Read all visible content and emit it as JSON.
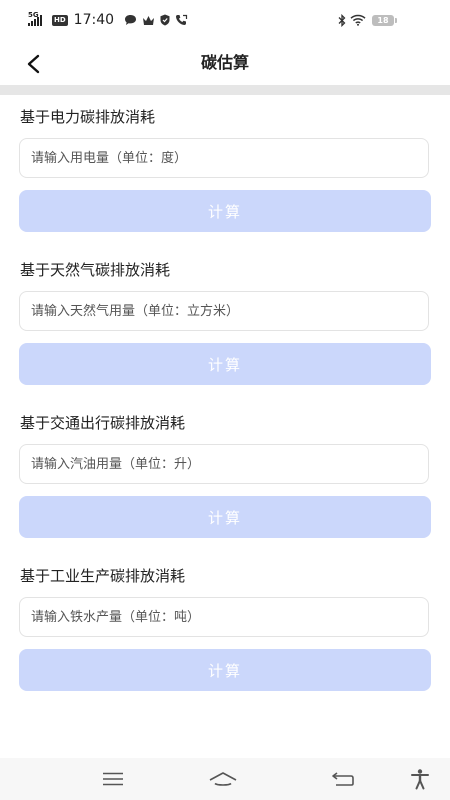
{
  "status_bar": {
    "network_label": "5G",
    "hd_label": "HD",
    "time": "17:40",
    "battery_level": "18"
  },
  "header": {
    "title": "碳估算",
    "back_icon": "chevron-left-icon"
  },
  "sections": [
    {
      "title": "基于电力碳排放消耗",
      "input_placeholder": "请输入用电量（单位：度）",
      "input_value": "",
      "button_label": "计算"
    },
    {
      "title": "基于天然气碳排放消耗",
      "input_placeholder": "请输入天然气用量（单位：立方米）",
      "input_value": "",
      "button_label": "计算"
    },
    {
      "title": "基于交通出行碳排放消耗",
      "input_placeholder": "请输入汽油用量（单位：升）",
      "input_value": "",
      "button_label": "计算"
    },
    {
      "title": "基于工业生产碳排放消耗",
      "input_placeholder": "请输入铁水产量（单位：吨）",
      "input_value": "",
      "button_label": "计算"
    }
  ],
  "nav_bar": {
    "menu_icon": "menu-icon",
    "home_icon": "home-icon",
    "back_icon": "back-icon",
    "accessibility_icon": "accessibility-icon"
  },
  "colors": {
    "button_bg": "#cbd7fb",
    "divider": "#e6e6e6",
    "nav_bg": "#f7f7f7"
  }
}
